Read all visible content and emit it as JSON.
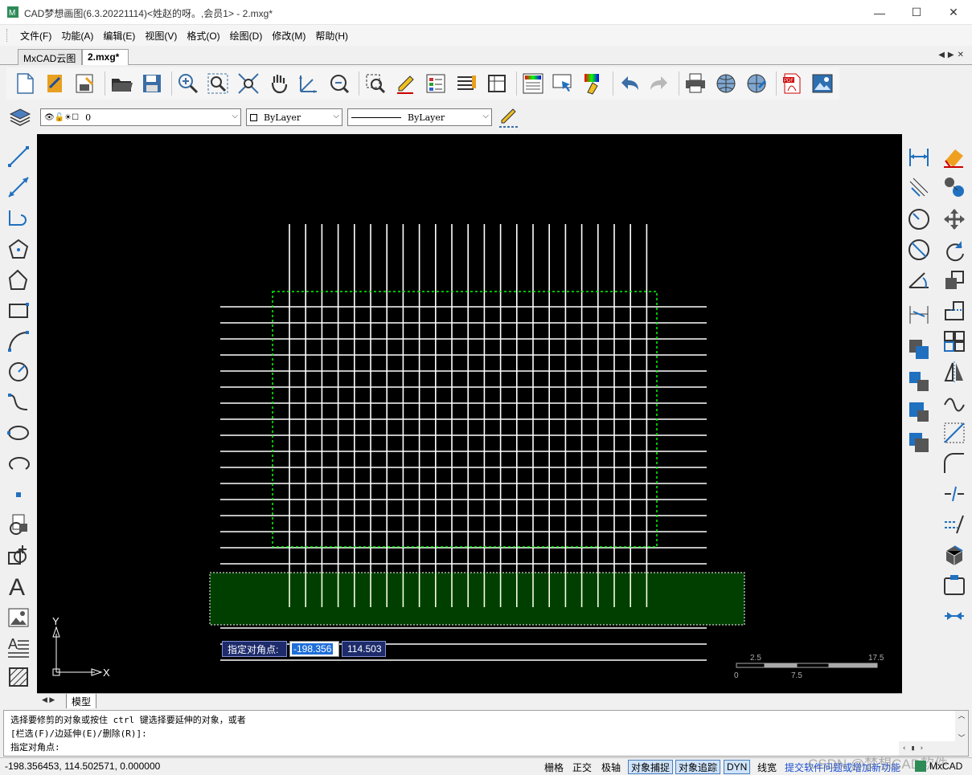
{
  "window": {
    "title": "CAD梦想画图(6.3.20221114)<姓赵的呀。,会员1> - 2.mxg*",
    "minimize": "—",
    "maximize": "☐",
    "close": "✕"
  },
  "menu": [
    "文件(F)",
    "功能(A)",
    "编辑(E)",
    "视图(V)",
    "格式(O)",
    "绘图(D)",
    "修改(M)",
    "帮助(H)"
  ],
  "tabs": [
    {
      "label": "MxCAD云图",
      "active": false
    },
    {
      "label": "2.mxg*",
      "active": true
    }
  ],
  "layer_bar": {
    "layer_name": "0",
    "color": "ByLayer",
    "linetype": "ByLayer"
  },
  "canvas": {
    "prompt_label": "指定对角点:",
    "input_x": "-198.356",
    "input_y": "114.503",
    "axis_x": "X",
    "axis_y": "Y",
    "scale_labels": {
      "top_left": "2.5",
      "top_right": "17.5",
      "bottom_left": "0",
      "bottom_mid": "7.5"
    },
    "colors": {
      "background": "#000000",
      "grid_lines": "#ffffff",
      "selection_dotted": "#00ff00",
      "crossing_fill": "#003f00"
    }
  },
  "model_tab": "模型",
  "command": {
    "lines": [
      "选择要修剪的对象或按住 ctrl 键选择要延伸的对象，或者",
      "[栏选(F)/边延伸(E)/删除(R)]:",
      "指定对角点:"
    ]
  },
  "status": {
    "coords": "-198.356453,  114.502571,  0.000000",
    "toggles": [
      {
        "label": "栅格",
        "on": false
      },
      {
        "label": "正交",
        "on": false
      },
      {
        "label": "极轴",
        "on": false
      },
      {
        "label": "对象捕捉",
        "on": true
      },
      {
        "label": "对象追踪",
        "on": true
      },
      {
        "label": "DYN",
        "on": true
      },
      {
        "label": "线宽",
        "on": false
      }
    ],
    "link": "提交软件问题或增加新功能",
    "brand": "MxCAD",
    "watermark": "CSDN @梦想CAD软件"
  }
}
